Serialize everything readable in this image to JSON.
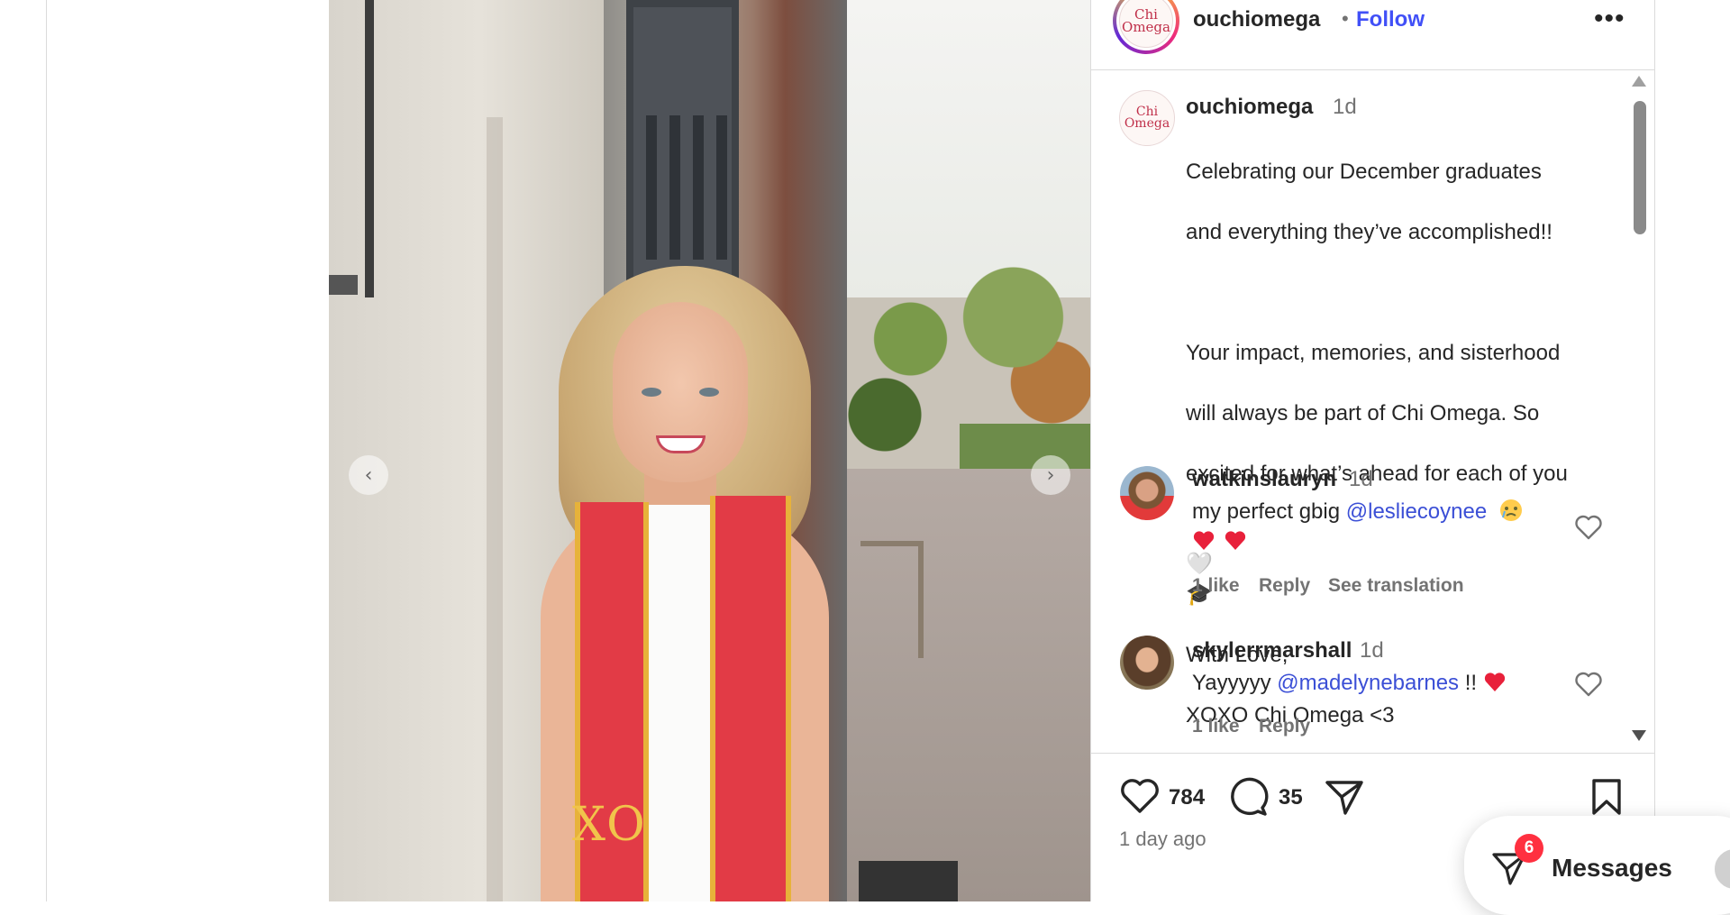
{
  "post": {
    "username": "ouchiomega",
    "follow_label": "Follow",
    "separator": "•",
    "logo_text_line1": "Chi",
    "logo_text_line2": "Omega"
  },
  "carousel": {
    "prev_icon": "‹",
    "next_icon": "›"
  },
  "photo": {
    "stole_lettering": "XO"
  },
  "caption": {
    "username": "ouchiomega",
    "time": "1d",
    "text_line1": "Celebrating our December graduates",
    "text_line2": "and everything they’ve accomplished!!",
    "text_line3": "Your impact, memories, and sisterhood",
    "text_line4": "will always be part of Chi Omega. So",
    "text_line5": "excited for what’s ahead for each of you",
    "emoji_1": "🤍",
    "emoji_2": "🎓",
    "text_line6": "With Love,",
    "text_line7": "XOXO Chi Omega <3"
  },
  "comments": [
    {
      "username": "watkinslauryn",
      "time": "1d",
      "text_prefix": "my perfect gbig ",
      "mention": "@lesliecoynee",
      "likes": "1 like",
      "reply": "Reply",
      "translation": "See translation"
    },
    {
      "username": "skylerrmarshall",
      "time": "1d",
      "text_prefix": "Yayyyyy ",
      "mention": "@madelynebarnes",
      "text_suffix": " !!",
      "likes": "1 like",
      "reply": "Reply"
    }
  ],
  "actions": {
    "like_count": "784",
    "comment_count": "35",
    "timestamp": "1 day ago"
  },
  "messages": {
    "label": "Messages",
    "badge_count": "6"
  },
  "colors": {
    "follow_blue": "#4150f7",
    "mention_blue": "#3b4fd6",
    "badge_red": "#ff3040",
    "heart_red": "#e8203a"
  },
  "icons": [
    "more-icon",
    "heart-icon",
    "comment-icon",
    "share-icon",
    "bookmark-icon",
    "messages-icon",
    "chevron-left-icon",
    "chevron-right-icon"
  ]
}
